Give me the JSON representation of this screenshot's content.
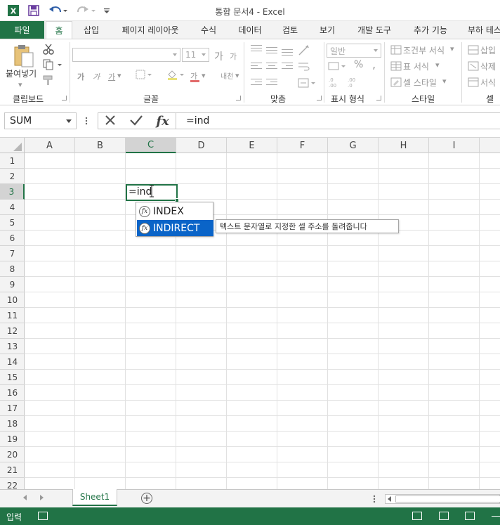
{
  "app": {
    "window_title": "통합 문서4 - Excel",
    "brand_color": "#217346",
    "highlight_color": "#0a64c8"
  },
  "quick_access": {
    "app_icon": "excel-logo-icon",
    "save_icon": "save-icon",
    "undo_icon": "undo-icon",
    "redo_icon": "redo-icon",
    "customize_icon": "customize-qat-icon"
  },
  "tabs": [
    "파일",
    "홈",
    "삽입",
    "페이지 레이아웃",
    "수식",
    "데이터",
    "검토",
    "보기",
    "개발 도구",
    "추가 기능",
    "부하 테스"
  ],
  "active_tab": "홈",
  "ribbon": {
    "clipboard": {
      "label": "클립보드",
      "paste": "붙여넣기"
    },
    "font": {
      "label": "글꼴",
      "font_name": "",
      "font_size": "11",
      "grow": "가",
      "shrink": "가",
      "bold": "가",
      "italic": "가",
      "underline": "가",
      "font_color": "가",
      "phonetic": "내천"
    },
    "alignment": {
      "label": "맞춤"
    },
    "number": {
      "label": "표시 형식",
      "format": "일반",
      "percent": "%",
      "comma": ","
    },
    "styles": {
      "label": "스타일",
      "conditional": "조건부 서식",
      "table": "표 서식",
      "cell_styles": "셀 스타일"
    },
    "cells": {
      "label": "셀",
      "insert": "삽입",
      "delete": "삭제",
      "format": "서식"
    }
  },
  "formula_bar": {
    "name_box": "SUM",
    "formula": "=ind",
    "fx": "fx"
  },
  "grid": {
    "columns": [
      "A",
      "B",
      "C",
      "D",
      "E",
      "F",
      "G",
      "H",
      "I"
    ],
    "rows": [
      "1",
      "2",
      "3",
      "4",
      "5",
      "6",
      "7",
      "8",
      "9",
      "10",
      "11",
      "12",
      "13",
      "14",
      "15",
      "16",
      "17",
      "18",
      "19",
      "20",
      "21",
      "22"
    ],
    "selected_column": "C",
    "selected_row": "3",
    "active_cell_text": "=ind"
  },
  "autocomplete": {
    "items": [
      {
        "label": "INDEX",
        "highlighted": false
      },
      {
        "label": "INDIRECT",
        "highlighted": true
      }
    ],
    "fx_glyph": "fx",
    "tooltip": "텍스트 문자열로 지정한 셀 주소를 돌려줍니다"
  },
  "sheets": {
    "tabs": [
      "Sheet1"
    ],
    "active": "Sheet1",
    "add": "+"
  },
  "status": {
    "mode": "입력"
  }
}
